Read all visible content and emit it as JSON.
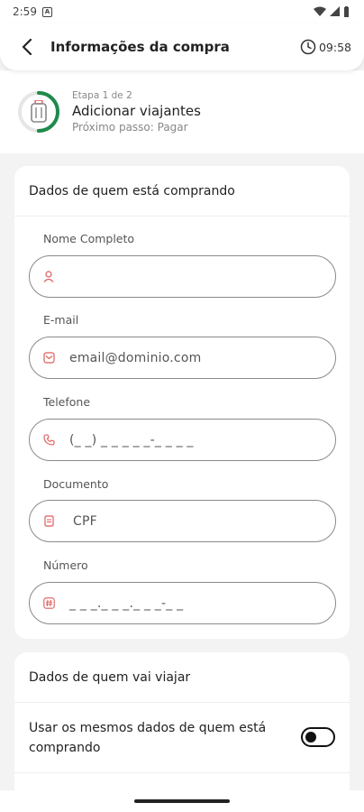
{
  "status_bar": {
    "time": "2:59"
  },
  "header": {
    "title": "Informações da compra",
    "timer": "09:58"
  },
  "progress": {
    "step_label": "Etapa 1 de 2",
    "step_title": "Adicionar viajantes",
    "next_step": "Próximo passo: Pagar",
    "completion": 0.5
  },
  "buyer": {
    "section_title": "Dados de quem está comprando",
    "fields": [
      {
        "label": "Nome Completo",
        "value": "",
        "icon": "user-icon"
      },
      {
        "label": "E-mail",
        "value": "email@dominio.com",
        "icon": "mail-icon"
      },
      {
        "label": "Telefone",
        "value": "(_ _) _ _ _ _ _-_ _ _ _",
        "icon": "phone-icon"
      },
      {
        "label": "Documento",
        "value": "CPF",
        "icon": "document-icon"
      },
      {
        "label": "Número",
        "value": "_ _ _._ _ _._ _ _-_ _",
        "icon": "hash-icon"
      }
    ]
  },
  "traveler": {
    "section_title": "Dados de quem vai viajar",
    "same_data_label": "Usar os mesmos dados de quem está comprando",
    "same_data_enabled": false
  },
  "colors": {
    "accent": "#1e8a4c",
    "icon_red": "#e05a5a"
  }
}
